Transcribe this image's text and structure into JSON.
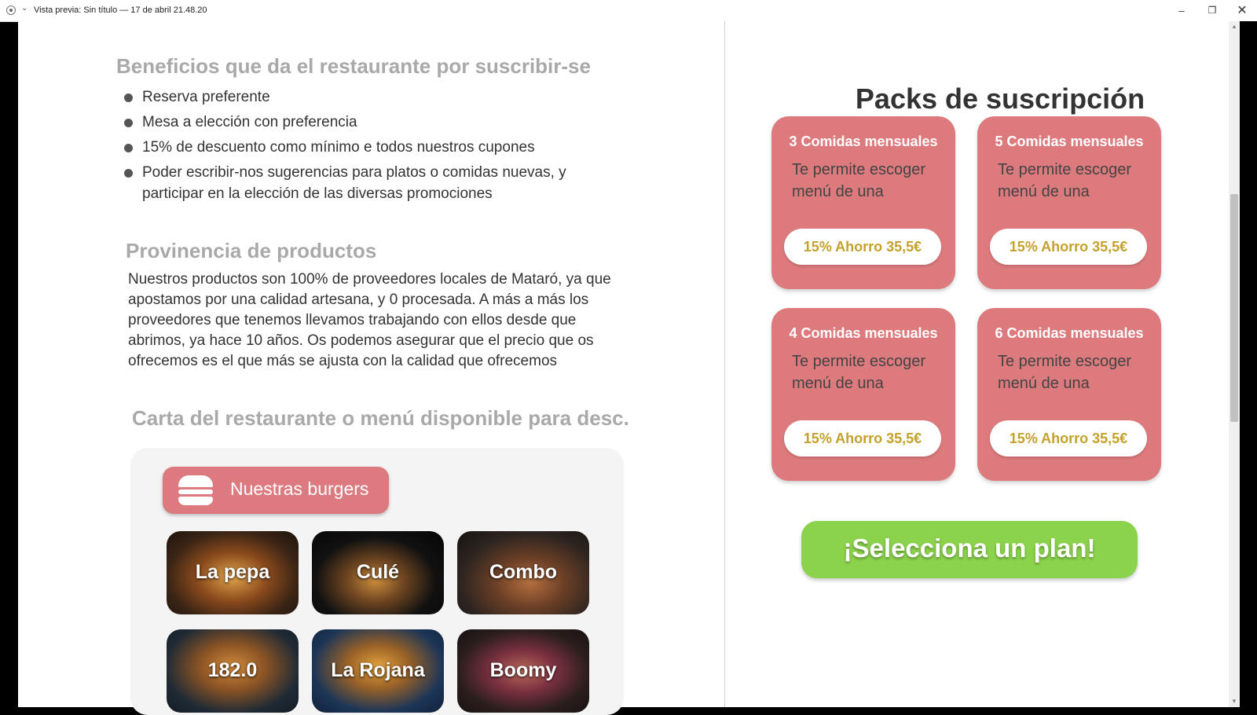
{
  "window": {
    "title": "Vista previa: Sin título — 17 de abril 21.48.20",
    "minimize_glyph": "–",
    "maximize_glyph": "❐",
    "close_glyph": "✕",
    "chevron_glyph": "⌄"
  },
  "benefits": {
    "title": "Beneficios que da el restaurante por suscribir-se",
    "items": [
      "Reserva preferente",
      "Mesa a elección con preferencia",
      "15% de descuento como mínimo e todos nuestros cupones",
      "Poder escribir-nos sugerencias para platos o comidas nuevas, y participar en la elección de las diversas promociones"
    ]
  },
  "provenance": {
    "title": "Provinencia de productos",
    "text": "Nuestros productos son 100% de proveedores locales de Mataró, ya que apostamos por una calidad artesana, y 0 procesada. A más a más los proveedores que tenemos llevamos trabajando con ellos desde que abrimos, ya hace 10 años. Os podemos asegurar que el precio que os ofrecemos es el que más se ajusta con la calidad que ofrecemos"
  },
  "menu": {
    "title": "Carta del restaurante o menú disponible para desc.",
    "tab_label": "Nuestras burgers",
    "burgers": [
      "La pepa",
      "Culé",
      "Combo",
      "182.0",
      "La Rojana",
      "Boomy"
    ]
  },
  "packs": {
    "title": "Packs de suscripción",
    "items": [
      {
        "title": "3 Comidas mensuales",
        "desc": "Te permite escoger menú de una",
        "price": "15% Ahorro 35,5€"
      },
      {
        "title": "5 Comidas mensuales",
        "desc": "Te permite escoger menú de una",
        "price": "15% Ahorro 35,5€"
      },
      {
        "title": "4 Comidas mensuales",
        "desc": "Te permite escoger menú de una",
        "price": "15% Ahorro 35,5€"
      },
      {
        "title": "6 Comidas mensuales",
        "desc": "Te permite escoger menú de una",
        "price": "15% Ahorro 35,5€"
      }
    ],
    "cta_label": "¡Selecciona un plan!"
  },
  "colors": {
    "pack_bg": "#dd7a7d",
    "price_text": "#c4a12a",
    "cta_bg": "#8cd34d",
    "section_title": "#a9a9a9"
  }
}
